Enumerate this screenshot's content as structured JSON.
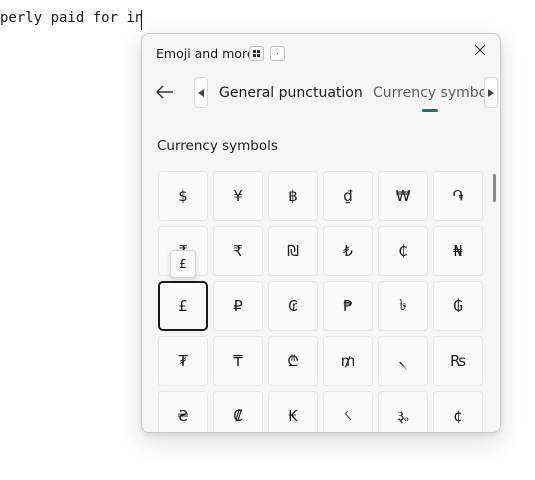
{
  "document": {
    "text": "perly paid for in"
  },
  "panel": {
    "title": "Emoji and more",
    "period_key": ".",
    "tabs": [
      {
        "label": "General punctuation"
      },
      {
        "label": "Currency symbols"
      }
    ],
    "section_title": "Currency symbols",
    "tooltip": "£",
    "symbols": [
      "$",
      "¥",
      "฿",
      "₫",
      "₩",
      "֏",
      "₹",
      "₹",
      "₪",
      "₺",
      "₵",
      "₦",
      "£",
      "₽",
      "₢",
      "₱",
      "৳",
      "₲",
      "₮",
      "₸",
      "₾",
      "₥",
      "৲",
      "₨",
      "₴",
      "₡",
      "₭",
      "৻",
      "૱",
      "¢"
    ],
    "selected_symbol": "£",
    "colors": {
      "accent": "#0f7b6c"
    }
  }
}
